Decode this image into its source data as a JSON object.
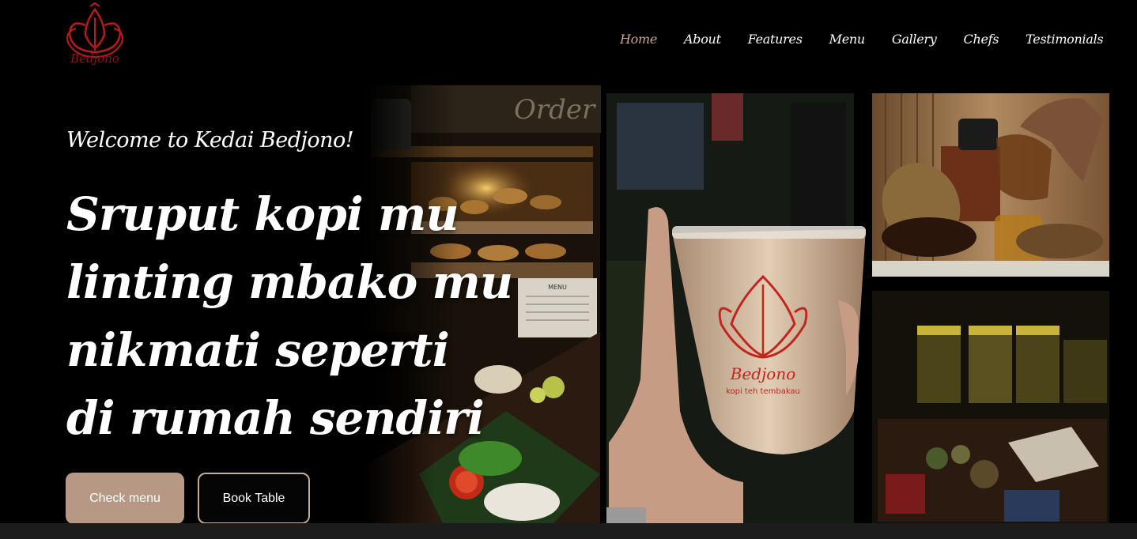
{
  "brand": {
    "logo_text": "Bedjono",
    "color": "#b81b1b"
  },
  "nav": {
    "items": [
      {
        "label": "Home",
        "active": true
      },
      {
        "label": "About"
      },
      {
        "label": "Features"
      },
      {
        "label": "Menu"
      },
      {
        "label": "Gallery"
      },
      {
        "label": "Chefs"
      },
      {
        "label": "Testimonials"
      }
    ]
  },
  "hero": {
    "welcome": "Welcome to Kedai Bedjono!",
    "headline": [
      "Sruput kopi mu",
      "linting mbako mu",
      "nikmati seperti",
      "di rumah sendiri"
    ],
    "cta_primary": "Check menu",
    "cta_secondary": "Book Table"
  },
  "photos": {
    "cup_brand": "Bedjono",
    "cup_tagline": "kopi teh tembakau",
    "shelf_sign": "Order",
    "menu_board": "MENU"
  },
  "colors": {
    "accent": "#b69884",
    "accent_border": "#c9ab95",
    "background": "#000000"
  }
}
